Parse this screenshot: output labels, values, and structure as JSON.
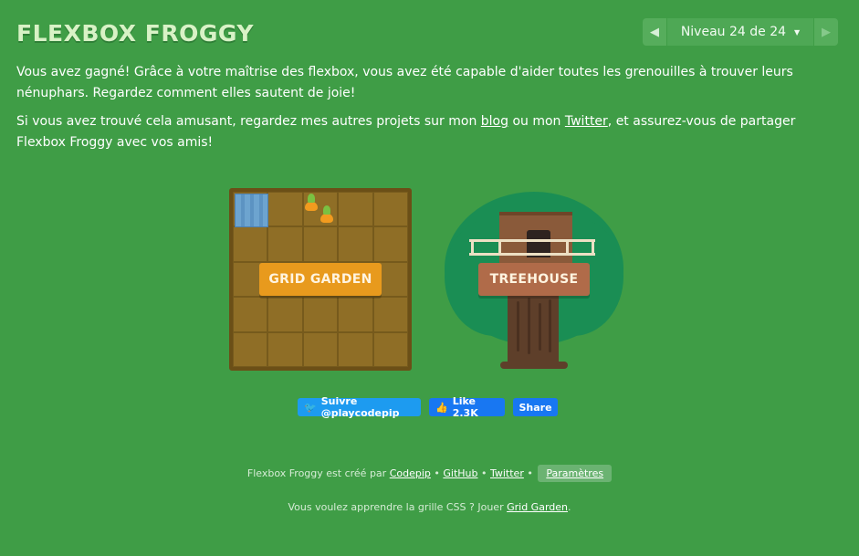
{
  "header": {
    "logo": "FLEXBOX FROGGY",
    "level_indicator": "Niveau 24 de 24",
    "prev_icon": "triangle-left-icon",
    "next_icon": "triangle-right-icon",
    "caret_icon": "caret-down-icon"
  },
  "content": {
    "p1": "Vous avez gagné! Grâce à votre maîtrise des flexbox, vous avez été capable d'aider toutes les grenouilles à trouver leurs nénuphars. Regardez comment elles sautent de joie!",
    "p2_prefix": "Si vous avez trouvé cela amusant, regardez mes autres projets sur mon ",
    "p2_blog": "blog",
    "p2_mid": " ou mon ",
    "p2_twitter": "Twitter",
    "p2_suffix": ", et assurez-vous de partager Flexbox Froggy avec vos amis!"
  },
  "projects": {
    "grid_garden": "GRID GARDEN",
    "treehouse": "TREEHOUSE"
  },
  "social": {
    "twitter_follow": "Suivre @playcodepip",
    "fb_like": "Like 2.3K",
    "fb_share": "Share",
    "twitter_icon": "bird-icon",
    "like_icon": "thumbs-up-icon"
  },
  "footer": {
    "line1_prefix": "Flexbox Froggy est créé par ",
    "codepip": "Codepip",
    "sep": " • ",
    "github": "GitHub",
    "twitter": "Twitter",
    "settings": "Paramètres",
    "line2_prefix": "Vous voulez apprendre la grille CSS ? Jouer ",
    "grid_garden_link": "Grid Garden",
    "line2_suffix": "."
  },
  "colors": {
    "background": "#3f9d46",
    "grid_garden_button": "#e89a1d",
    "treehouse_button": "#b06b49"
  }
}
